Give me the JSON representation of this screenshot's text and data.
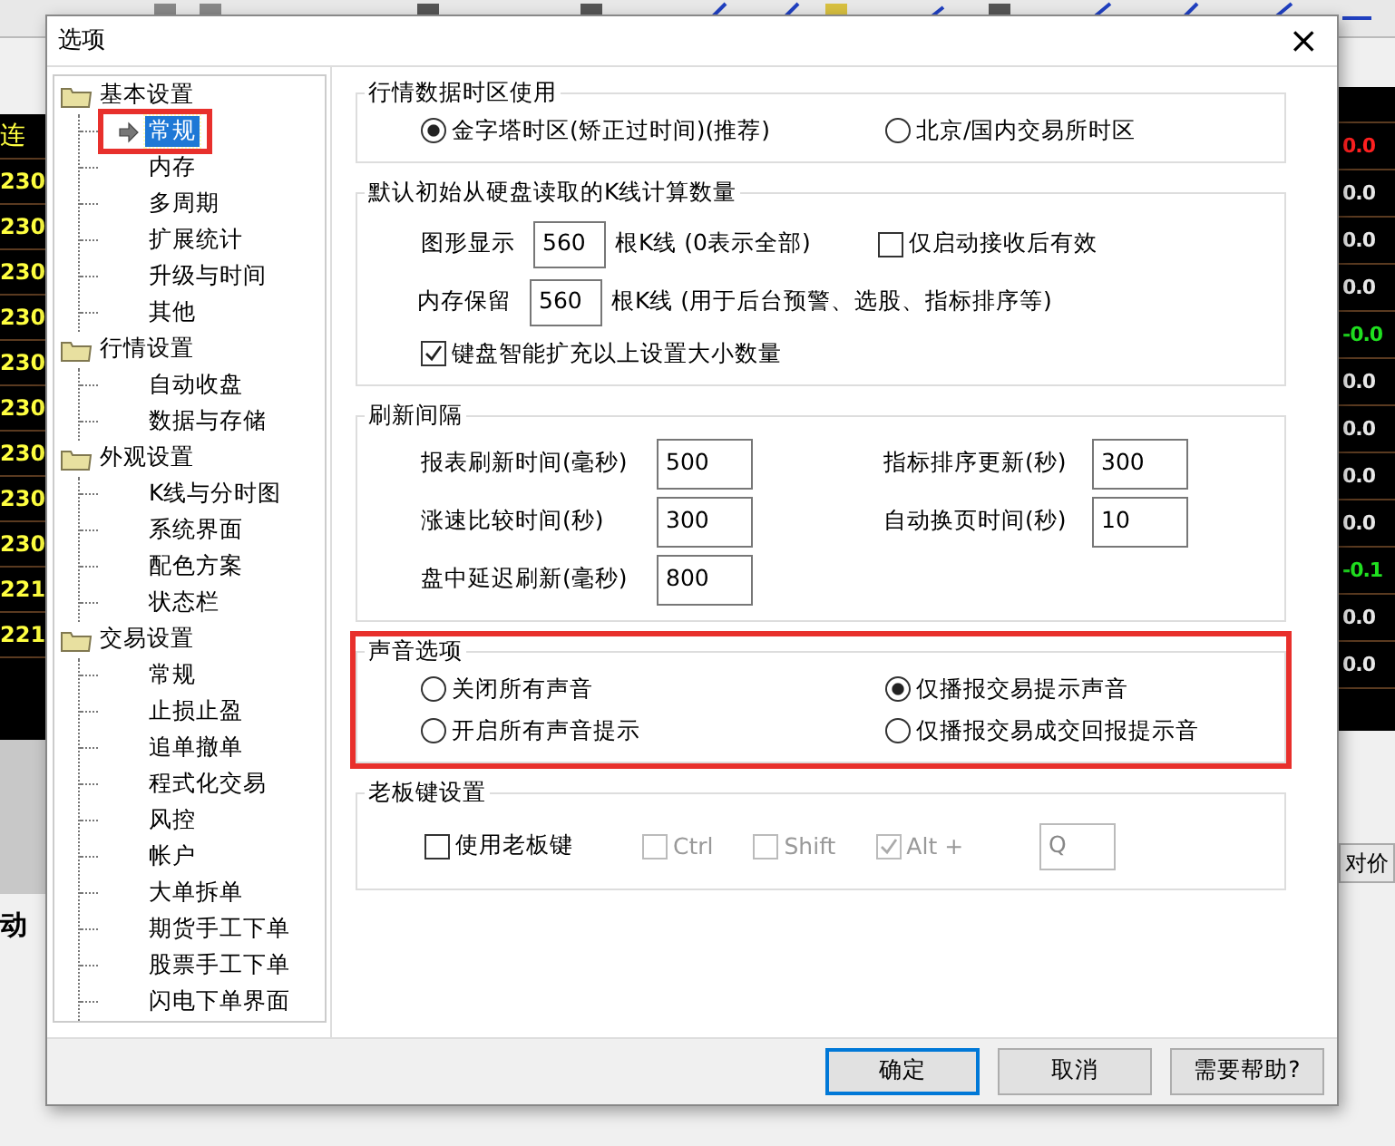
{
  "app": {
    "left_header": "连",
    "left_codes": [
      "230",
      "230",
      "230",
      "230",
      "230",
      "230",
      "230",
      "230",
      "230",
      "221",
      "221"
    ],
    "right_values": [
      {
        "text": "0.0",
        "up": true,
        "down": false
      },
      {
        "text": "0.0",
        "up": false,
        "down": false
      },
      {
        "text": "0.0",
        "up": false,
        "down": false
      },
      {
        "text": "0.0",
        "up": false,
        "down": false
      },
      {
        "text": "-0.0",
        "up": false,
        "down": true
      },
      {
        "text": "0.0",
        "up": false,
        "down": false
      },
      {
        "text": "0.0",
        "up": false,
        "down": false
      },
      {
        "text": "0.0",
        "up": false,
        "down": false
      },
      {
        "text": "0.0",
        "up": false,
        "down": false
      },
      {
        "text": "-0.1",
        "up": false,
        "down": true
      },
      {
        "text": "0.0",
        "up": false,
        "down": false
      },
      {
        "text": "0.0",
        "up": false,
        "down": false
      }
    ],
    "left_label": "动",
    "right_button": "对价"
  },
  "dialog": {
    "title": "选项",
    "close": "×",
    "tree": [
      {
        "label": "基本设置",
        "children": [
          {
            "label": "常规",
            "selected": true,
            "highlighted": true
          },
          {
            "label": "内存",
            "selected": false,
            "highlighted": false
          },
          {
            "label": "多周期",
            "selected": false,
            "highlighted": false
          },
          {
            "label": "扩展统计",
            "selected": false,
            "highlighted": false
          },
          {
            "label": "升级与时间",
            "selected": false,
            "highlighted": false
          },
          {
            "label": "其他",
            "selected": false,
            "highlighted": false
          }
        ]
      },
      {
        "label": "行情设置",
        "children": [
          {
            "label": "自动收盘",
            "selected": false,
            "highlighted": false
          },
          {
            "label": "数据与存储",
            "selected": false,
            "highlighted": false
          }
        ]
      },
      {
        "label": "外观设置",
        "children": [
          {
            "label": "K线与分时图",
            "selected": false,
            "highlighted": false
          },
          {
            "label": "系统界面",
            "selected": false,
            "highlighted": false
          },
          {
            "label": "配色方案",
            "selected": false,
            "highlighted": false
          },
          {
            "label": "状态栏",
            "selected": false,
            "highlighted": false
          }
        ]
      },
      {
        "label": "交易设置",
        "children": [
          {
            "label": "常规",
            "selected": false,
            "highlighted": false
          },
          {
            "label": "止损止盈",
            "selected": false,
            "highlighted": false
          },
          {
            "label": "追单撤单",
            "selected": false,
            "highlighted": false
          },
          {
            "label": "程式化交易",
            "selected": false,
            "highlighted": false
          },
          {
            "label": "风控",
            "selected": false,
            "highlighted": false
          },
          {
            "label": "帐户",
            "selected": false,
            "highlighted": false
          },
          {
            "label": "大单拆单",
            "selected": false,
            "highlighted": false
          },
          {
            "label": "期货手工下单",
            "selected": false,
            "highlighted": false
          },
          {
            "label": "股票手工下单",
            "selected": false,
            "highlighted": false
          },
          {
            "label": "闪电下单界面",
            "selected": false,
            "highlighted": false
          }
        ]
      }
    ],
    "sections": [
      {
        "kind": "radios",
        "title": "行情数据时区使用",
        "highlighted": false,
        "options": [
          {
            "label": "金字塔时区(矫正过时间)(推荐)",
            "selected": true
          },
          {
            "label": "北京/国内交易所时区",
            "selected": false
          }
        ]
      },
      {
        "kind": "kline",
        "title": "默认初始从硬盘读取的K线计算数量",
        "highlighted": false,
        "rows": [
          {
            "label": "图形显示",
            "value": "560",
            "unit": "根K线 (0表示全部)",
            "check": {
              "label": "仅启动接收后有效",
              "checked": false
            }
          },
          {
            "label": "内存保留",
            "value": "560",
            "unit": "根K线  (用于后台预警、选股、指标排序等)"
          }
        ],
        "check": {
          "label": "键盘智能扩充以上设置大小数量",
          "checked": true
        }
      },
      {
        "kind": "fields",
        "title": "刷新间隔",
        "highlighted": false,
        "fields": [
          {
            "label": "报表刷新时间(毫秒)",
            "value": "500"
          },
          {
            "label": "指标排序更新(秒)",
            "value": "300"
          },
          {
            "label": "涨速比较时间(秒)",
            "value": "300"
          },
          {
            "label": "自动换页时间(秒)",
            "value": "10"
          },
          {
            "label": "盘中延迟刷新(毫秒)",
            "value": "800"
          }
        ]
      },
      {
        "kind": "radios",
        "title": "声音选项",
        "highlighted": true,
        "options": [
          {
            "label": "关闭所有声音",
            "selected": false
          },
          {
            "label": "仅播报交易提示声音",
            "selected": true
          },
          {
            "label": "开启所有声音提示",
            "selected": false
          },
          {
            "label": "仅播报交易成交回报提示音",
            "selected": false
          }
        ]
      },
      {
        "kind": "bosskey",
        "title": "老板键设置",
        "highlighted": false,
        "check": {
          "label": "使用老板键",
          "checked": false
        },
        "modifiers": [
          {
            "label": "Ctrl",
            "checked": false,
            "disabled": true
          },
          {
            "label": "Shift",
            "checked": false,
            "disabled": true
          },
          {
            "label": "Alt +",
            "checked": true,
            "disabled": true
          }
        ],
        "key": "Q"
      }
    ],
    "buttons": [
      {
        "label": "确定",
        "default": true
      },
      {
        "label": "取消",
        "default": false
      },
      {
        "label": "需要帮助?",
        "default": false
      }
    ]
  }
}
